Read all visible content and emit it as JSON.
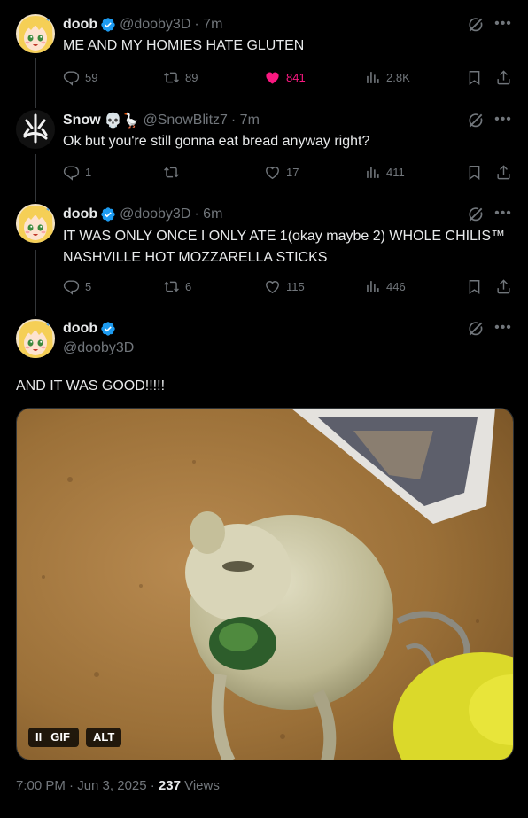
{
  "tweets": [
    {
      "name": "doob",
      "handle": "@dooby3D",
      "time": "· 7m",
      "text": "ME AND MY HOMIES HATE GLUTEN",
      "replies": "59",
      "retweets": "89",
      "likes": "841",
      "views": "2.8K"
    },
    {
      "name": "Snow",
      "emoji": "💀🪿",
      "handle": "@SnowBlitz7",
      "time": "· 7m",
      "text": "Ok but you're still gonna eat bread anyway right?",
      "replies": "1",
      "retweets": "",
      "likes": "17",
      "views": "411"
    },
    {
      "name": "doob",
      "handle": "@dooby3D",
      "time": "· 6m",
      "text": "IT WAS ONLY ONCE I ONLY ATE 1(okay maybe 2) WHOLE CHILIS™ NASHVILLE HOT MOZZARELLA STICKS",
      "replies": "5",
      "retweets": "6",
      "likes": "115",
      "views": "446"
    }
  ],
  "main": {
    "name": "doob",
    "handle": "@dooby3D",
    "text": "AND IT WAS GOOD!!!!!",
    "gif_label": "GIF",
    "alt_label": "ALT",
    "pause_label": "II",
    "timestamp": "7:00 PM · Jun 3, 2025 · ",
    "view_count": "237",
    "views_label": " Views"
  },
  "colors": {
    "background": "#000000",
    "text": "#e7e9ea",
    "secondary": "#71767b",
    "like_active": "#f91880",
    "verified": "#1d9bf0"
  },
  "icons": [
    "verified-badge-icon",
    "grok-icon",
    "more-icon",
    "reply-icon",
    "retweet-icon",
    "like-icon",
    "views-icon",
    "bookmark-icon",
    "share-icon"
  ]
}
